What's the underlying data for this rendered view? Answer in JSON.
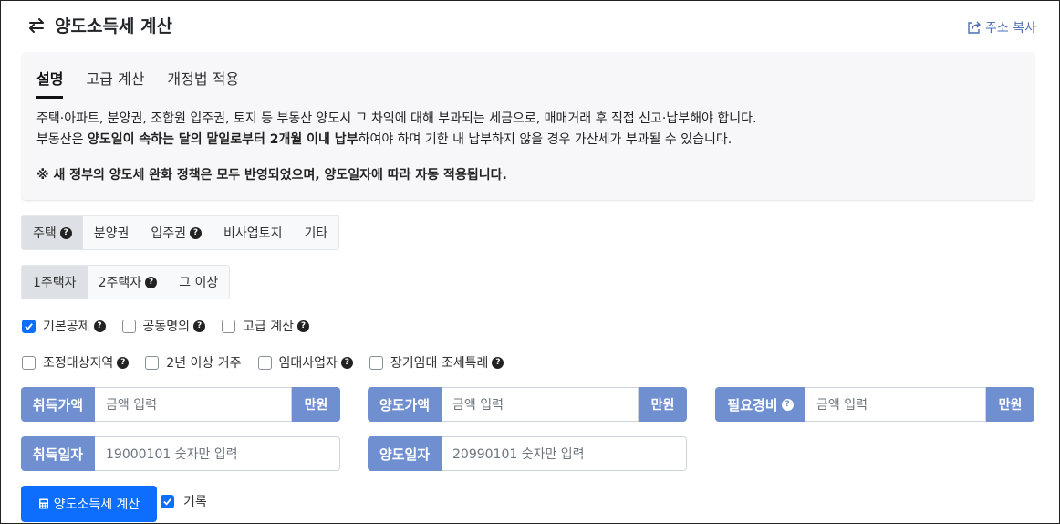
{
  "header": {
    "title": "양도소득세 계산",
    "copy_label": "주소 복사",
    "title_icon": "swap-arrows-icon",
    "copy_icon": "share-icon"
  },
  "info": {
    "tabs": [
      {
        "label": "설명",
        "active": true
      },
      {
        "label": "고급 계산",
        "active": false
      },
      {
        "label": "개정법 적용",
        "active": false
      }
    ],
    "line1": "주택·아파트, 분양권, 조합원 입주권, 토지 등 부동산 양도시 그 차익에 대해 부과되는 세금으로, 매매거래 후 직접 신고·납부해야 합니다.",
    "line2_prefix": "부동산은 ",
    "line2_bold": "양도일이 속하는 달의 말일로부터 2개월 이내 납부",
    "line2_suffix": "하여야 하며 기한 내 납부하지 않을 경우 가산세가 부과될 수 있습니다.",
    "notice": "※ 새 정부의 양도세 완화 정책은 모두 반영되었으며, 양도일자에 따라 자동 적용됩니다."
  },
  "property_types": [
    {
      "label": "주택",
      "active": true,
      "help": true
    },
    {
      "label": "분양권",
      "active": false,
      "help": false
    },
    {
      "label": "입주권",
      "active": false,
      "help": true
    },
    {
      "label": "비사업토지",
      "active": false,
      "help": false
    },
    {
      "label": "기타",
      "active": false,
      "help": false
    }
  ],
  "house_counts": [
    {
      "label": "1주택자",
      "active": true,
      "help": false
    },
    {
      "label": "2주택자",
      "active": false,
      "help": true
    },
    {
      "label": "그 이상",
      "active": false,
      "help": false
    }
  ],
  "options_row1": [
    {
      "label": "기본공제",
      "checked": true,
      "help": true
    },
    {
      "label": "공동명의",
      "checked": false,
      "help": true
    },
    {
      "label": "고급 계산",
      "checked": false,
      "help": true
    }
  ],
  "options_row2": [
    {
      "label": "조정대상지역",
      "checked": false,
      "help": true
    },
    {
      "label": "2년 이상 거주",
      "checked": false,
      "help": false
    },
    {
      "label": "임대사업자",
      "checked": false,
      "help": true
    },
    {
      "label": "장기임대 조세특례",
      "checked": false,
      "help": true
    }
  ],
  "fields": {
    "acq_price": {
      "label": "취득가액",
      "placeholder": "금액 입력",
      "unit": "만원"
    },
    "sale_price": {
      "label": "양도가액",
      "placeholder": "금액 입력",
      "unit": "만원"
    },
    "expenses": {
      "label": "필요경비",
      "placeholder": "금액 입력",
      "unit": "만원"
    },
    "acq_date": {
      "label": "취득일자",
      "placeholder": "19000101 숫자만 입력"
    },
    "sale_date": {
      "label": "양도일자",
      "placeholder": "20990101 숫자만 입력"
    }
  },
  "calc_button": "양도소득세 계산",
  "record": {
    "label": "기록",
    "checked": true
  },
  "colors": {
    "accent": "#0d6efd",
    "label_bg": "#6f8fd0",
    "link": "#4a6fb4",
    "info_bg": "#f7f7f9"
  }
}
